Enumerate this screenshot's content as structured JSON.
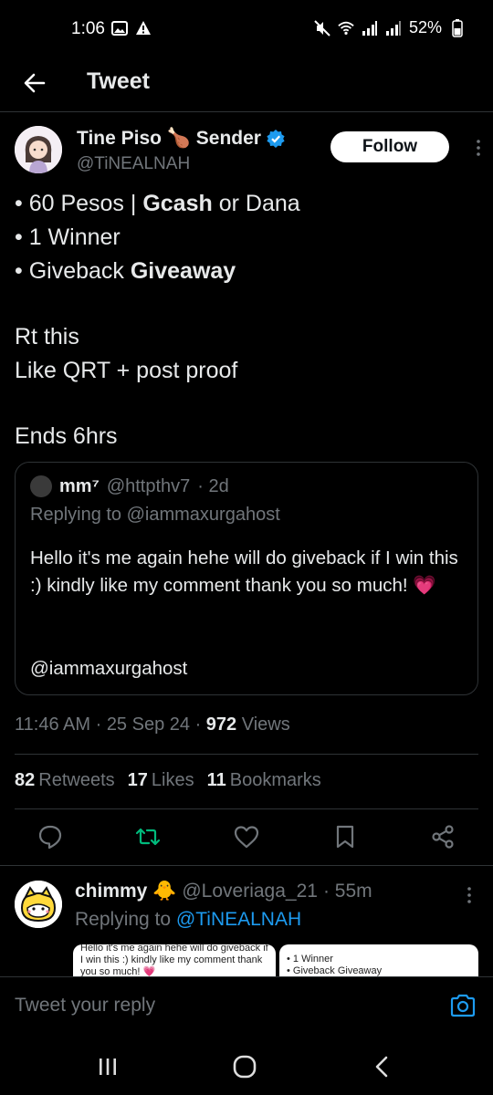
{
  "status_bar": {
    "time": "1:06",
    "battery": "52%"
  },
  "header": {
    "title": "Tweet"
  },
  "author": {
    "name": "Tine Piso 🍗 Sender",
    "handle": "@TiNEALNAH",
    "follow_label": "Follow"
  },
  "tweet": {
    "line1_prefix": "• 60 Pesos | ",
    "line1_bold": "Gcash",
    "line1_suffix": " or Dana",
    "line2": "• 1 Winner",
    "line3_prefix": "• Giveback ",
    "line3_bold": "Giveaway",
    "line4": "Rt this",
    "line5": "Like QRT + post proof",
    "line6": "Ends 6hrs"
  },
  "quote": {
    "name": "mm⁷",
    "handle": "@httpthv7",
    "time": "· 2d",
    "replying_to": "Replying to @iammaxurgahost",
    "text": "Hello it's me again hehe will do giveback if I win this :) kindly like my comment thank you so much! 💗",
    "mention": "@iammaxurgahost"
  },
  "meta": {
    "time": "11:46 AM",
    "date": "25 Sep 24",
    "views_count": "972",
    "views_label": "Views"
  },
  "stats": {
    "retweets_count": "82",
    "retweets_label": "Retweets",
    "likes_count": "17",
    "likes_label": "Likes",
    "bookmarks_count": "11",
    "bookmarks_label": "Bookmarks"
  },
  "reply": {
    "name": "chimmy 🐥",
    "handle": "@Loveriaga_21",
    "time": "· 55m",
    "replying_prefix": "Replying to ",
    "replying_handle": "@TiNEALNAH",
    "thumb1_text": "Hello it's me again hehe will do giveback if I win this :) kindly like my comment thank you so much! 💗",
    "thumb2_line1": "• 1 Winner",
    "thumb2_line2": "• Giveback Giveaway"
  },
  "composer": {
    "placeholder": "Tweet your reply"
  },
  "colors": {
    "accent": "#1d9bf0",
    "retweet": "#00ba7c",
    "background": "#000000",
    "muted": "#71767b"
  }
}
